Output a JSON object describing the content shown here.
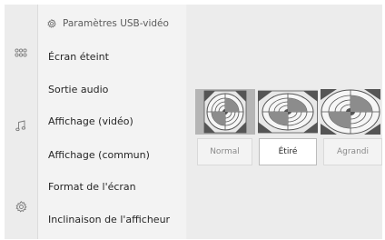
{
  "header": {
    "title": "Paramètres USB-vidéo",
    "icon": "gear-icon"
  },
  "sidebar": {
    "icons": [
      "apps-grid-icon",
      "music-note-icon",
      "gear-icon"
    ]
  },
  "menu": {
    "items": [
      {
        "label": "Écran éteint"
      },
      {
        "label": "Sortie audio"
      },
      {
        "label": "Affichage (vidéo)"
      },
      {
        "label": "Affichage (commun)"
      },
      {
        "label": "Format de l'écran"
      },
      {
        "label": "Inclinaison de l'afficheur"
      }
    ]
  },
  "aspect": {
    "options": [
      {
        "label": "Normal",
        "selected": false
      },
      {
        "label": "Étiré",
        "selected": true
      },
      {
        "label": "Agrandi",
        "selected": false
      }
    ]
  },
  "colors": {
    "background": "#eeeeee",
    "menu": "#f3f3f3",
    "selected_button": "#ffffff",
    "text": "#262626",
    "muted": "#8a8a8a"
  }
}
